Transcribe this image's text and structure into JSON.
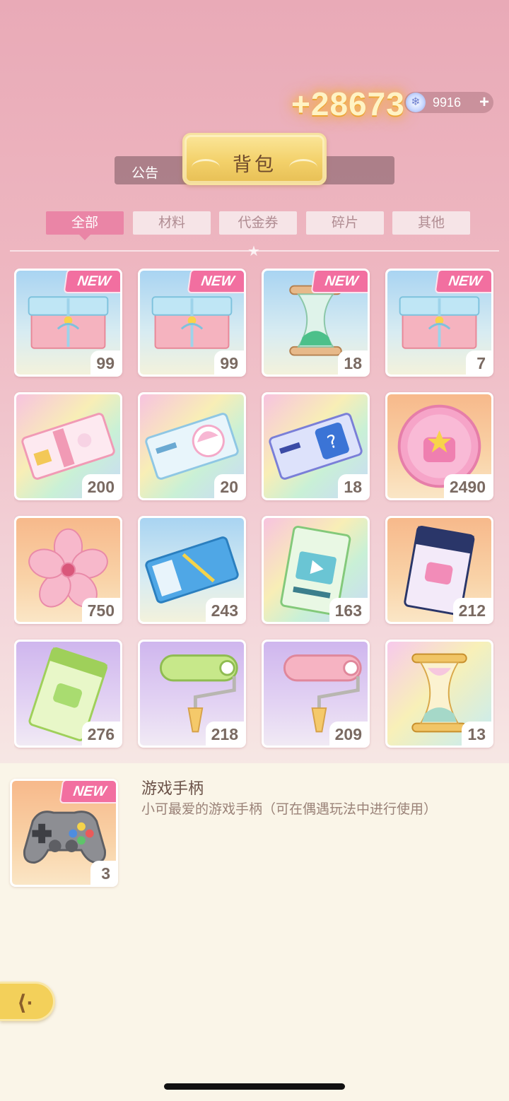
{
  "header": {
    "reward_popup": "+28673",
    "gem": {
      "icon": "snowflake-gem-icon",
      "count": "9916",
      "plus": "+"
    },
    "notice_label": "公告",
    "title": "背包"
  },
  "tabs": [
    {
      "label": "全部",
      "active": true
    },
    {
      "label": "材料",
      "active": false
    },
    {
      "label": "代金券",
      "active": false
    },
    {
      "label": "碎片",
      "active": false
    },
    {
      "label": "其他",
      "active": false
    }
  ],
  "items": [
    {
      "icon": "gift-box-icon",
      "count": "99",
      "new": "NEW",
      "bg": "bg-blue"
    },
    {
      "icon": "gift-box-icon",
      "count": "99",
      "new": "NEW",
      "bg": "bg-blue"
    },
    {
      "icon": "green-hourglass-icon",
      "count": "18",
      "new": "NEW",
      "bg": "bg-blue"
    },
    {
      "icon": "gift-box-icon",
      "count": "7",
      "new": "NEW",
      "bg": "bg-blue"
    },
    {
      "icon": "pink-ticket-icon",
      "count": "200",
      "new": "",
      "bg": "bg-rainbow"
    },
    {
      "icon": "avatar-ticket-icon",
      "count": "20",
      "new": "",
      "bg": "bg-rainbow"
    },
    {
      "icon": "mystery-ticket-icon",
      "count": "18",
      "new": "",
      "bg": "bg-rainbow"
    },
    {
      "icon": "pink-coin-icon",
      "count": "2490",
      "new": "",
      "bg": "bg-orange"
    },
    {
      "icon": "sakura-flower-icon",
      "count": "750",
      "new": "",
      "bg": "bg-orange"
    },
    {
      "icon": "blue-ticket-icon",
      "count": "243",
      "new": "",
      "bg": "bg-blue"
    },
    {
      "icon": "video-ticket-icon",
      "count": "163",
      "new": "",
      "bg": "bg-rainbow"
    },
    {
      "icon": "navy-ticket-icon",
      "count": "212",
      "new": "",
      "bg": "bg-orange"
    },
    {
      "icon": "green-ticket-icon",
      "count": "276",
      "new": "",
      "bg": "bg-purple"
    },
    {
      "icon": "green-paint-roller-icon",
      "count": "218",
      "new": "",
      "bg": "bg-purple"
    },
    {
      "icon": "pink-paint-roller-icon",
      "count": "209",
      "new": "",
      "bg": "bg-purple"
    },
    {
      "icon": "golden-hourglass-icon",
      "count": "13",
      "new": "",
      "bg": "bg-rainbow2"
    }
  ],
  "detail": {
    "icon": "gamepad-icon",
    "new": "NEW",
    "count": "3",
    "title": "游戏手柄",
    "description": "小可最爱的游戏手柄（可在偶遇玩法中进行使用）"
  },
  "colors": {
    "accent_pink": "#ea85a6",
    "new_tag": "#f26fa0",
    "gold": "#f3d16a"
  }
}
